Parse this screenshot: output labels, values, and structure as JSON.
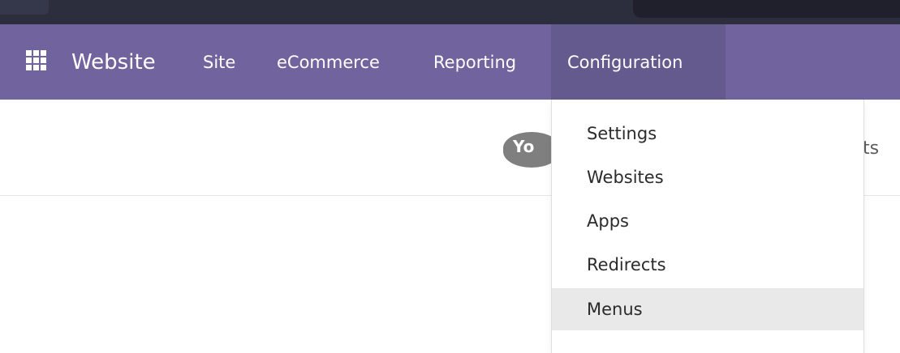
{
  "navbar": {
    "brand": "Website",
    "items": [
      {
        "label": "Site"
      },
      {
        "label": "eCommerce"
      },
      {
        "label": "Reporting"
      },
      {
        "label": "Configuration",
        "active": true
      }
    ],
    "accent_color": "#71639e",
    "active_color": "#655a8e"
  },
  "content": {
    "logo_text": "Yo",
    "partial_text": "ts"
  },
  "dropdown": {
    "items": [
      {
        "label": "Settings"
      },
      {
        "label": "Websites"
      },
      {
        "label": "Apps"
      },
      {
        "label": "Redirects"
      },
      {
        "label": "Menus",
        "highlighted": true
      }
    ],
    "highlight_color": "#e9e9e9"
  }
}
